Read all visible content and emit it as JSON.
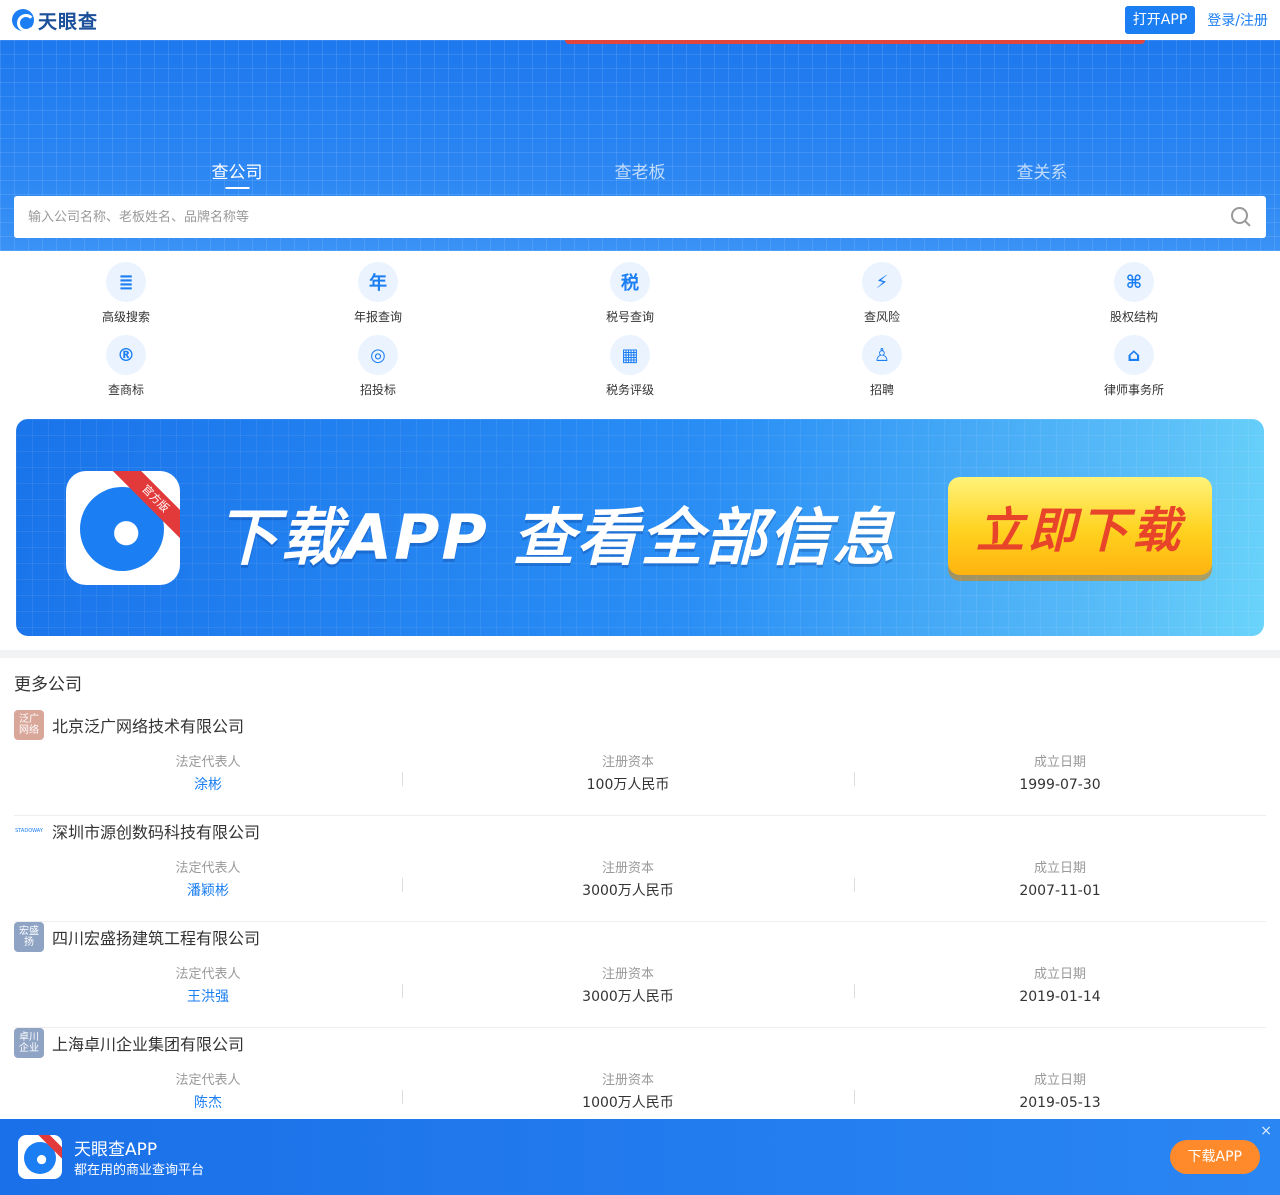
{
  "topbar": {
    "logo_text": "天眼查",
    "open_app": "打开APP",
    "login": "登录/注册"
  },
  "hero": {
    "tabs": [
      {
        "label": "查公司",
        "active": true
      },
      {
        "label": "查老板",
        "active": false
      },
      {
        "label": "查关系",
        "active": false
      }
    ],
    "search_placeholder": "输入公司名称、老板姓名、品牌名称等"
  },
  "features": [
    [
      {
        "label": "高级搜索",
        "icon": "advanced-search-icon",
        "glyph": "≣"
      },
      {
        "label": "年报查询",
        "icon": "annual-report-icon",
        "glyph": "年"
      },
      {
        "label": "税号查询",
        "icon": "tax-id-icon",
        "glyph": "税"
      },
      {
        "label": "查风险",
        "icon": "risk-icon",
        "glyph": "⚡"
      },
      {
        "label": "股权结构",
        "icon": "equity-structure-icon",
        "glyph": "⌘"
      }
    ],
    [
      {
        "label": "查商标",
        "icon": "trademark-icon",
        "glyph": "®"
      },
      {
        "label": "招投标",
        "icon": "bidding-icon",
        "glyph": "◎"
      },
      {
        "label": "税务评级",
        "icon": "tax-rating-icon",
        "glyph": "▦"
      },
      {
        "label": "招聘",
        "icon": "recruitment-icon",
        "glyph": "♙"
      },
      {
        "label": "律师事务所",
        "icon": "law-firm-icon",
        "glyph": "⌂"
      }
    ]
  ],
  "banner": {
    "badge": "官方版",
    "headline": "下载APP 查看全部信息",
    "button": "立即下载"
  },
  "more": {
    "title": "更多公司",
    "stat_labels": [
      "法定代表人",
      "注册资本",
      "成立日期"
    ],
    "companies": [
      {
        "name": "北京泛广网络技术有限公司",
        "logo_text": "泛广网络",
        "logo_color": "#d9a79a",
        "rep": "涂彬",
        "capital": "100万人民币",
        "date": "1999-07-30"
      },
      {
        "name": "深圳市源创数码科技有限公司",
        "logo_text": "STADOWAY",
        "logo_color": "",
        "rep": "潘颖彬",
        "capital": "3000万人民币",
        "date": "2007-11-01"
      },
      {
        "name": "四川宏盛扬建筑工程有限公司",
        "logo_text": "宏盛扬",
        "logo_color": "#8fa3c5",
        "rep": "王洪强",
        "capital": "3000万人民币",
        "date": "2019-01-14"
      },
      {
        "name": "上海卓川企业集团有限公司",
        "logo_text": "卓川企业",
        "logo_color": "#8fa3c5",
        "rep": "陈杰",
        "capital": "1000万人民币",
        "date": "2019-05-13"
      }
    ]
  },
  "appbar": {
    "badge": "官方版",
    "title": "天眼查APP",
    "subtitle": "都在用的商业查询平台",
    "button": "下载APP",
    "close": "×"
  }
}
